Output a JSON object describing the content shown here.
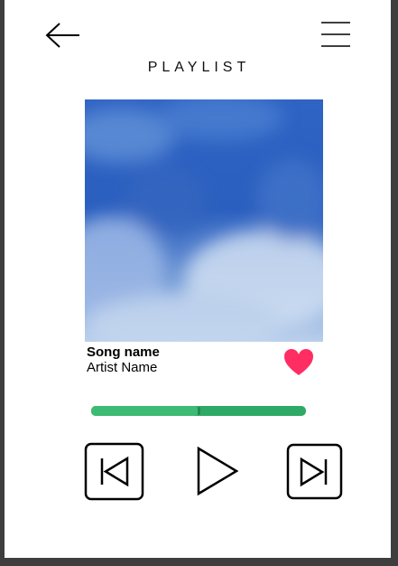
{
  "header": {
    "title": "PLAYLIST",
    "back_icon": "arrow-left-icon",
    "menu_icon": "hamburger-menu-icon"
  },
  "track": {
    "song_name": "Song name",
    "artist_name": "Artist Name",
    "favorite": true,
    "heart_color": "#ff2d62"
  },
  "player": {
    "progress": 0.5,
    "progress_color": "#2faa66",
    "controls": [
      "skip-previous-icon",
      "play-icon",
      "skip-next-icon"
    ]
  },
  "colors": {
    "background": "#3e3e3e",
    "card": "#ffffff"
  }
}
